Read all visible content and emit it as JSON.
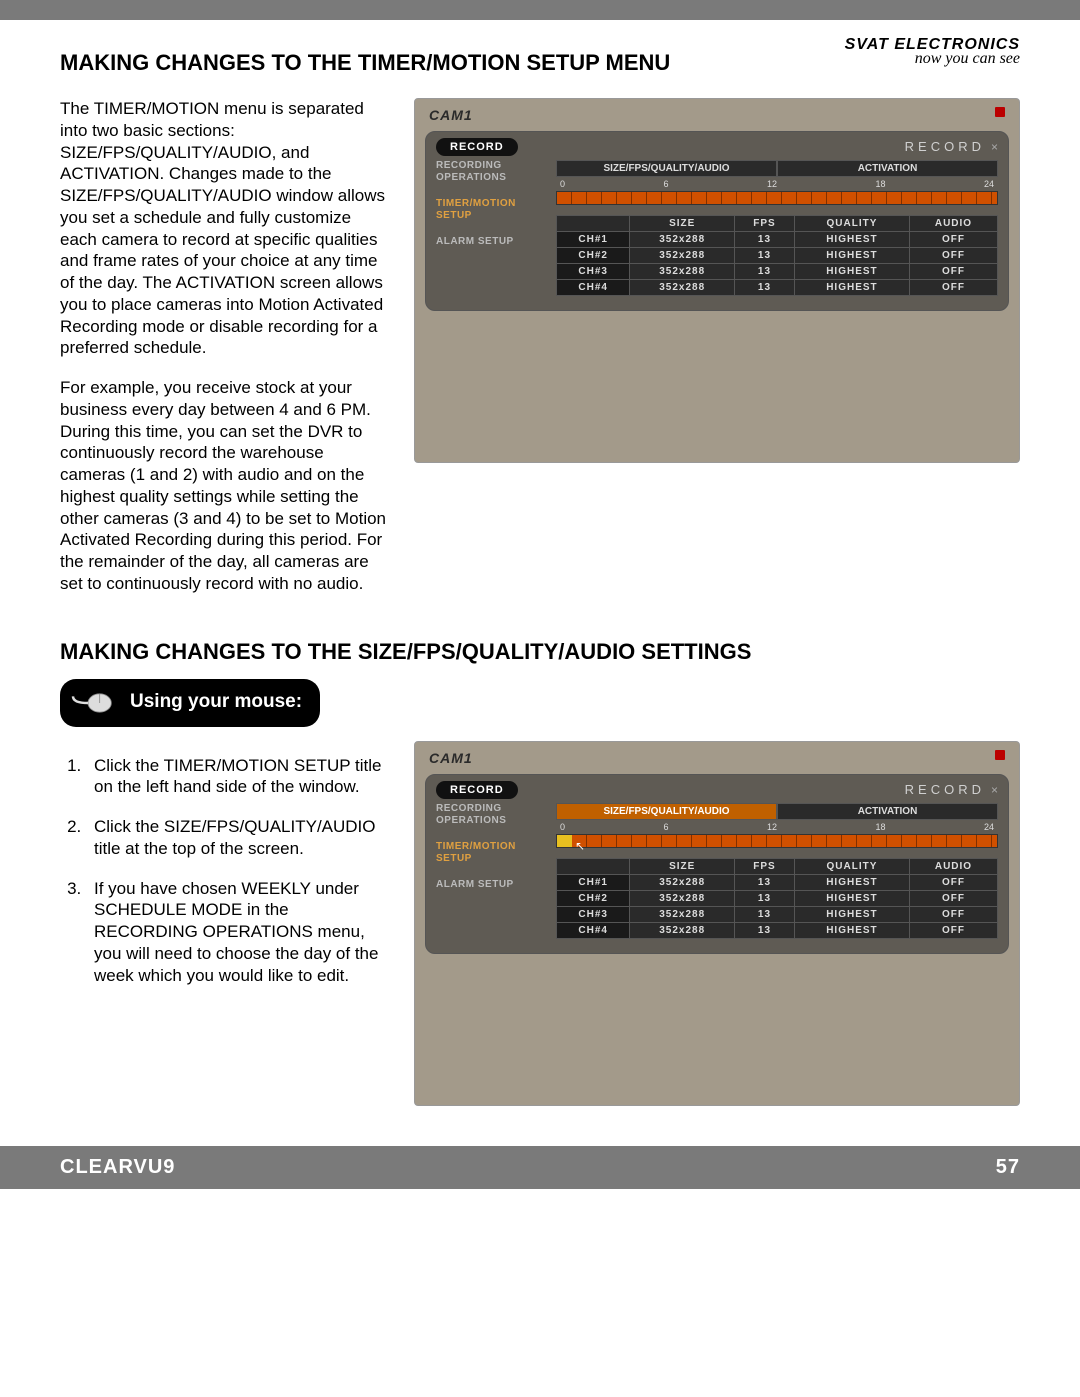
{
  "brand": "SVAT ELECTRONICS",
  "tagline": "now you can see",
  "section1_title": "MAKING CHANGES TO THE TIMER/MOTION SETUP MENU",
  "para1": "The TIMER/MOTION menu is separated into two basic sections:  SIZE/FPS/QUALITY/AUDIO, and ACTIVATION.  Changes made to the SIZE/FPS/QUALITY/AUDIO window allows you set a schedule and fully customize each camera to record at specific qualities and frame rates of your choice at any time of the day.  The ACTIVATION screen allows you to place cameras into Motion Activated Recording mode or disable recording for a preferred schedule.",
  "para2": "For example, you receive stock at your business every day between 4 and 6 PM.  During this time, you can set the DVR to continuously record the warehouse cameras (1 and 2) with audio and on the highest quality settings while setting the other cameras (3 and 4) to be set to Motion Activated Recording during this period.  For the remainder of the day, all cameras are set to continuously record with no audio.",
  "section2_title": "MAKING CHANGES TO THE SIZE/FPS/QUALITY/AUDIO SETTINGS",
  "mouse_label": "Using your mouse:",
  "steps": [
    "Click the TIMER/MOTION SETUP title on the left hand side of the window.",
    "Click the SIZE/FPS/QUALITY/AUDIO title at the top of the screen.",
    "If you have chosen WEEKLY under SCHEDULE MODE in the RECORDING OPERATIONS menu, you will need to choose the day of the week which you would like to edit."
  ],
  "shot": {
    "cam_label": "CAM1",
    "btn_record": "RECORD",
    "hdr_record": "RECORD",
    "close": "×",
    "sidebar": {
      "recording_ops": "RECORDING OPERATIONS",
      "timer_motion": "TIMER/MOTION SETUP",
      "alarm": "ALARM SETUP"
    },
    "tabs": {
      "size": "SIZE/FPS/QUALITY/AUDIO",
      "activation": "ACTIVATION"
    },
    "ruler": [
      "0",
      "6",
      "12",
      "18",
      "24"
    ],
    "cols": [
      "",
      "SIZE",
      "FPS",
      "QUALITY",
      "AUDIO"
    ],
    "rows": [
      {
        "ch": "CH#1",
        "size": "352x288",
        "fps": "13",
        "quality": "HIGHEST",
        "audio": "OFF"
      },
      {
        "ch": "CH#2",
        "size": "352x288",
        "fps": "13",
        "quality": "HIGHEST",
        "audio": "OFF"
      },
      {
        "ch": "CH#3",
        "size": "352x288",
        "fps": "13",
        "quality": "HIGHEST",
        "audio": "OFF"
      },
      {
        "ch": "CH#4",
        "size": "352x288",
        "fps": "13",
        "quality": "HIGHEST",
        "audio": "OFF"
      }
    ]
  },
  "footer_model": "CLEARVU9",
  "footer_page": "57"
}
